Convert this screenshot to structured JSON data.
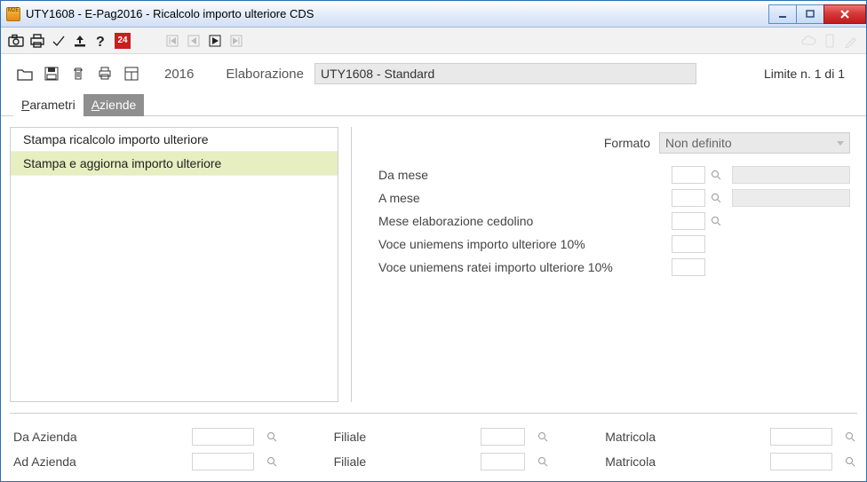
{
  "title": "UTY1608  - E-Pag2016  -  Ricalcolo importo ulteriore CDS",
  "toolbar": {
    "badge": "24"
  },
  "subbar": {
    "year": "2016",
    "elab_label": "Elaborazione",
    "elab_value": "UTY1608 - Standard",
    "limit_text": "Limite n. 1 di 1"
  },
  "tabs": {
    "parametri": "Parametri",
    "parametri_first": "P",
    "parametri_rest": "arametri",
    "aziende": "Aziende",
    "aziende_first": "A",
    "aziende_rest": "ziende"
  },
  "list": {
    "item0": "Stampa ricalcolo importo ulteriore",
    "item1": "Stampa e aggiorna importo ulteriore"
  },
  "form": {
    "formato_label": "Formato",
    "formato_value": "Non definito",
    "da_mese": "Da mese",
    "a_mese": "A  mese",
    "mese_elab": "Mese elaborazione cedolino",
    "voce_uni": "Voce uniemens importo ulteriore 10%",
    "voce_uni_ratei": "Voce uniemens ratei importo ulteriore 10%"
  },
  "filters": {
    "da_azienda": "Da Azienda",
    "ad_azienda": "Ad Azienda",
    "filiale": "Filiale",
    "matricola": "Matricola"
  }
}
